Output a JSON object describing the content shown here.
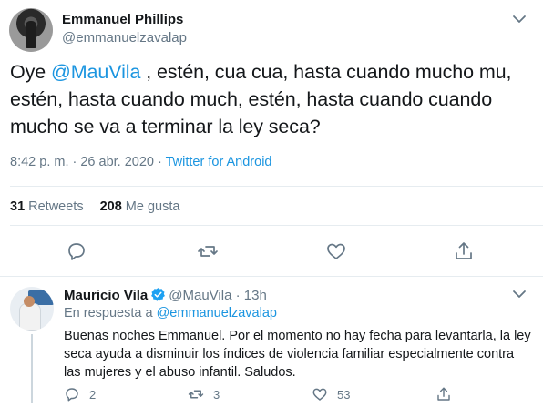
{
  "main_tweet": {
    "author": {
      "name": "Emmanuel Phillips",
      "handle": "@emmanuelzavalap"
    },
    "text": {
      "prefix": "Oye ",
      "mention": "@MauVila",
      "body": " , estén, cua cua, hasta cuando mucho mu, estén, hasta cuando much, estén, hasta cuando cuando mucho se va a terminar la ley seca?"
    },
    "timestamp": "8:42 p. m. · 26 abr. 2020 · ",
    "source": "Twitter for Android",
    "stats": {
      "retweets_count": "31",
      "retweets_label": "Retweets",
      "likes_count": "208",
      "likes_label": "Me gusta"
    }
  },
  "reply_tweet": {
    "author": {
      "name": "Mauricio Vila",
      "handle": "@MauVila"
    },
    "separator": "·",
    "time": "13h",
    "replying_prefix": "En respuesta a ",
    "replying_to": "@emmanuelzavalap",
    "text": "Buenas noches Emmanuel. Por el momento no hay fecha para levantarla, la ley seca ayuda a disminuir los índices de violencia familiar especialmente contra las mujeres y el abuso infantil. Saludos.",
    "counts": {
      "replies": "2",
      "retweets": "3",
      "likes": "53"
    }
  },
  "colors": {
    "accent": "#1b95e0",
    "muted": "#657786",
    "text": "#14171a",
    "border": "#e6ecf0"
  },
  "icons": [
    "caret-down-icon",
    "reply-icon",
    "retweet-icon",
    "like-icon",
    "share-icon",
    "verified-icon"
  ]
}
